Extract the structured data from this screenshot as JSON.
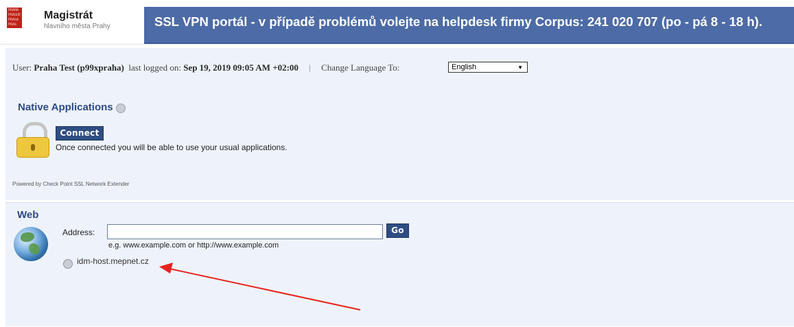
{
  "header": {
    "logo_title": "Magistrát",
    "logo_subtitle": "hlavního města Prahy",
    "logo_text": [
      "PRAHA",
      "PRAGUE",
      "PRAGA",
      "PRAG"
    ],
    "banner": "SSL VPN portál - v případě problémů volejte na helpdesk firmy Corpus: 241 020 707 (po - pá 8 - 18 h).",
    "banner_bg": "#4d6ba6"
  },
  "user_bar": {
    "user_label": "User:",
    "user_name": "Praha Test (p99xpraha)",
    "last_logged_label": "last logged on:",
    "last_logged_value": "Sep 19, 2019 09:05 AM +02:00",
    "separator": "|",
    "language_label": "Change Language To:",
    "language_selected": "English"
  },
  "native_apps": {
    "title": "Native Applications",
    "connect_label": "Connect",
    "description": "Once connected you will be able to use your usual applications.",
    "powered_by": "Powered by Check Point SSL Network Extender"
  },
  "web": {
    "title": "Web",
    "address_label": "Address:",
    "address_value": "",
    "go_label": "Go",
    "example_text": "e.g.  www.example.com  or  http://www.example.com",
    "bookmarks": [
      {
        "label": "idm-host.mepnet.cz"
      }
    ]
  },
  "colors": {
    "accent": "#2e4d82",
    "panel_bg": "#eef3fb",
    "annotation_arrow": "#e8231f"
  }
}
